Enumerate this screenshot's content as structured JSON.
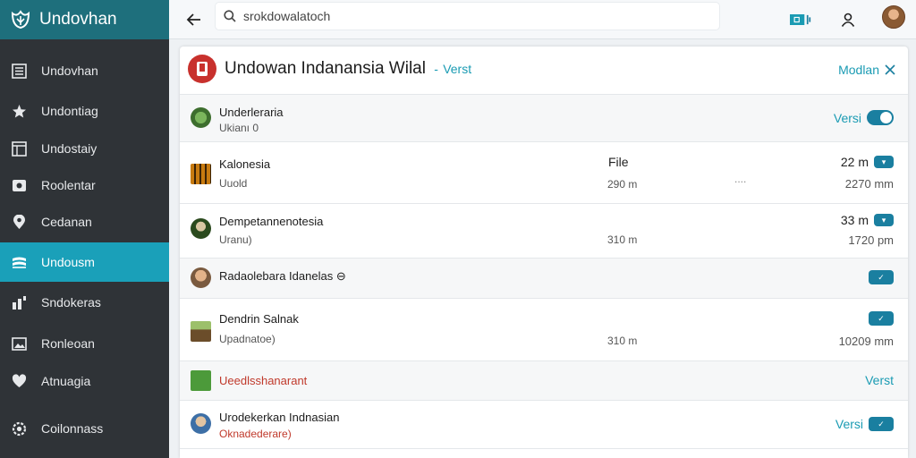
{
  "app": {
    "name": "Undovhan"
  },
  "sidebar": {
    "items": [
      {
        "label": "Undovhan",
        "icon": "list-icon"
      },
      {
        "label": "Undontiag",
        "icon": "star-icon"
      },
      {
        "label": "Undostaiy",
        "icon": "window-icon"
      },
      {
        "label": "Roolentar",
        "icon": "image-icon"
      },
      {
        "label": "Cedanan",
        "icon": "location-pin-icon"
      },
      {
        "label": "Undousm",
        "icon": "layers-icon"
      },
      {
        "label": "Sndokeras",
        "icon": "bar-chart-icon"
      },
      {
        "label": "Ronleoan",
        "icon": "photo-icon"
      },
      {
        "label": "Atnuagia",
        "icon": "heart-icon"
      },
      {
        "label": "Coilonnass",
        "icon": "settings-icon"
      }
    ]
  },
  "topbar": {
    "search_placeholder": "srokdowalatoch"
  },
  "card": {
    "title": "Undowan Indanansia Wilal",
    "separator": "-",
    "subtitle": "Verst",
    "action_label": "Modlan",
    "rows": [
      {
        "title": "Underleraria",
        "subtitle": "Ukianı 0",
        "right_link": "Versi"
      },
      {
        "title": "Kalonesia",
        "subtitle": "Uuold",
        "mid_head": "File",
        "mid": "290 m",
        "dots": "....",
        "right_top": "22 m",
        "right_bottom": "2270 mm"
      },
      {
        "title": "Dempetannenotesia",
        "subtitle": "Uranu)",
        "mid": "310 m",
        "right_top": "33 m",
        "right_bottom": "1720 pm"
      },
      {
        "title": "Radaolebara Idanelas",
        "title_mark": "⊖"
      },
      {
        "title": "Dendrin Salnak",
        "subtitle": "Upadnatoe)",
        "mid": "310 m",
        "right_bottom": "10209 mm"
      },
      {
        "title": "Ueedlsshanarant",
        "right_link": "Verst"
      },
      {
        "title": "Urodekerkan Indnasian",
        "subtitle": "Oknadederare)",
        "right_link": "Versi"
      }
    ]
  }
}
